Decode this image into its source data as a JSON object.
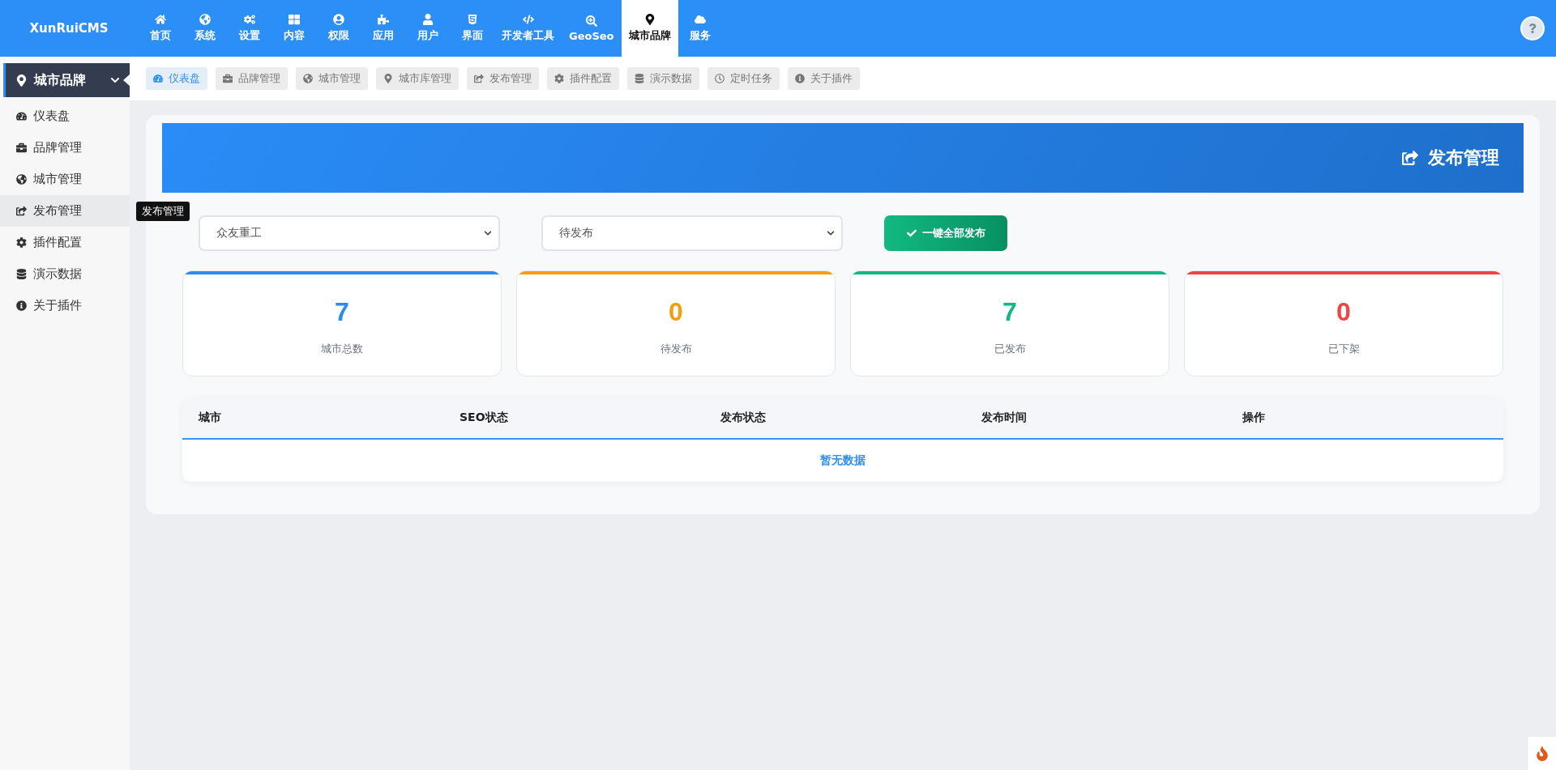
{
  "logo": {
    "text": "XunRuiCMS"
  },
  "top_nav": [
    {
      "label": "首页",
      "selected": false
    },
    {
      "label": "系统",
      "selected": false
    },
    {
      "label": "设置",
      "selected": false
    },
    {
      "label": "内容",
      "selected": false
    },
    {
      "label": "权限",
      "selected": false
    },
    {
      "label": "应用",
      "selected": false
    },
    {
      "label": "用户",
      "selected": false
    },
    {
      "label": "界面",
      "selected": false
    },
    {
      "label": "开发者工具",
      "selected": false
    },
    {
      "label": "GeoSeo",
      "selected": false
    },
    {
      "label": "城市品牌",
      "selected": true
    },
    {
      "label": "服务",
      "selected": false
    }
  ],
  "sidebar": {
    "title": "城市品牌",
    "items": [
      {
        "label": "仪表盘",
        "selected": false
      },
      {
        "label": "品牌管理",
        "selected": false
      },
      {
        "label": "城市管理",
        "selected": false
      },
      {
        "label": "发布管理",
        "selected": true
      },
      {
        "label": "插件配置",
        "selected": false
      },
      {
        "label": "演示数据",
        "selected": false
      },
      {
        "label": "关于插件",
        "selected": false
      }
    ]
  },
  "tooltip": "发布管理",
  "tabs": [
    {
      "label": "仪表盘",
      "selected": true
    },
    {
      "label": "品牌管理",
      "selected": false
    },
    {
      "label": "城市管理",
      "selected": false
    },
    {
      "label": "城市库管理",
      "selected": false
    },
    {
      "label": "发布管理",
      "selected": false
    },
    {
      "label": "插件配置",
      "selected": false
    },
    {
      "label": "演示数据",
      "selected": false
    },
    {
      "label": "定时任务",
      "selected": false
    },
    {
      "label": "关于插件",
      "selected": false
    }
  ],
  "banner": {
    "title": "发布管理"
  },
  "filters": [
    {
      "value": "众友重工"
    },
    {
      "value": "待发布"
    }
  ],
  "publish_all_button": "一键全部发布",
  "stats": [
    {
      "value": "7",
      "label": "城市总数",
      "color": "#2b8bf2"
    },
    {
      "value": "0",
      "label": "待发布",
      "color": "#f59e0b"
    },
    {
      "value": "7",
      "label": "已发布",
      "color": "#10b981"
    },
    {
      "value": "0",
      "label": "已下架",
      "color": "#ef4444"
    }
  ],
  "table": {
    "columns": [
      "城市",
      "SEO状态",
      "发布状态",
      "发布时间",
      "操作"
    ],
    "empty_text": "暂无数据"
  }
}
